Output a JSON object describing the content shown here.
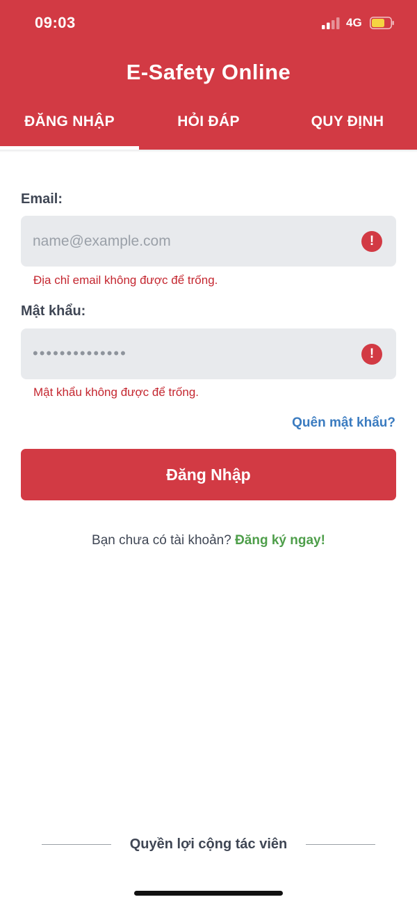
{
  "status_bar": {
    "time": "09:03",
    "network": "4G",
    "signal_icon": "cellular-signal-icon",
    "battery_icon": "battery-icon",
    "battery_color": "#f5d442"
  },
  "header": {
    "title": "E-Safety Online",
    "background_color": "#d23a44"
  },
  "tabs": [
    {
      "label": "ĐĂNG NHẬP",
      "active": true
    },
    {
      "label": "HỎI ĐÁP",
      "active": false
    },
    {
      "label": "QUY ĐỊNH",
      "active": false
    }
  ],
  "form": {
    "email": {
      "label": "Email:",
      "placeholder": "name@example.com",
      "value": "",
      "error": "Địa chỉ email không được để trống.",
      "error_icon": "error-exclamation-icon"
    },
    "password": {
      "label": "Mật khẩu:",
      "placeholder": "••••••••••••••",
      "value": "",
      "error": "Mật khẩu không được để trống.",
      "error_icon": "error-exclamation-icon"
    },
    "forgot_password": "Quên mật khẩu?",
    "submit_label": "Đăng Nhập"
  },
  "signup": {
    "prompt": "Bạn chưa có tài khoản?",
    "link": "Đăng ký ngay!",
    "link_color": "#4e9e4a"
  },
  "footer": {
    "text": "Quyền lợi cộng tác viên"
  }
}
